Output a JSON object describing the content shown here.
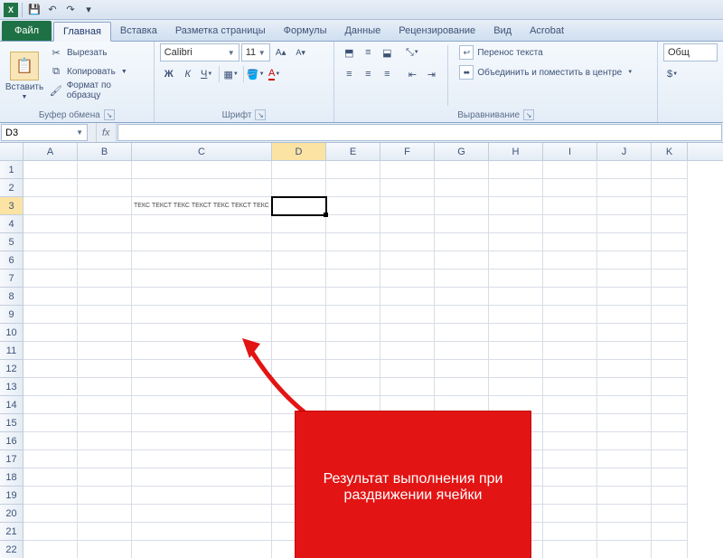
{
  "titlebar": {
    "qat": {
      "save_title": "Сохранить",
      "undo_title": "Отменить",
      "redo_title": "Повторить"
    }
  },
  "tabs": {
    "file": "Файл",
    "items": [
      "Главная",
      "Вставка",
      "Разметка страницы",
      "Формулы",
      "Данные",
      "Рецензирование",
      "Вид",
      "Acrobat"
    ],
    "active_index": 0
  },
  "ribbon": {
    "clipboard": {
      "paste": "Вставить",
      "cut": "Вырезать",
      "copy": "Копировать",
      "format_painter": "Формат по образцу",
      "group_label": "Буфер обмена"
    },
    "font": {
      "name": "Calibri",
      "size": "11",
      "group_label": "Шрифт"
    },
    "alignment": {
      "wrap": "Перенос текста",
      "merge": "Объединить и поместить в центре",
      "group_label": "Выравнивание"
    },
    "number": {
      "format": "Общ",
      "currency": "$"
    }
  },
  "formula_bar": {
    "name_box": "D3",
    "fx": "fx"
  },
  "grid": {
    "columns": [
      {
        "label": "A",
        "w": 60
      },
      {
        "label": "B",
        "w": 60
      },
      {
        "label": "C",
        "w": 155
      },
      {
        "label": "D",
        "w": 60
      },
      {
        "label": "E",
        "w": 60
      },
      {
        "label": "F",
        "w": 60
      },
      {
        "label": "G",
        "w": 60
      },
      {
        "label": "H",
        "w": 60
      },
      {
        "label": "I",
        "w": 60
      },
      {
        "label": "J",
        "w": 60
      },
      {
        "label": "K",
        "w": 40
      }
    ],
    "rows": 22,
    "selected_col": 3,
    "selected_row": 2,
    "cells": {
      "C3": "ТЕКС ТЕКСТ ТЕКС ТЕКСТ ТЕКС ТЕКСТ ТЕКС ТЕКСТ"
    }
  },
  "annotation": {
    "text": "Результат выполнения при раздвижении ячейки"
  }
}
